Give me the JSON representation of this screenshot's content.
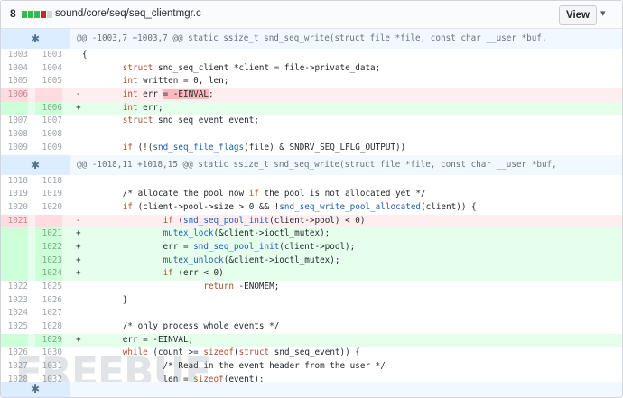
{
  "header": {
    "change_count": "8",
    "bar_colors": [
      "#2cbe4e",
      "#2cbe4e",
      "#2cbe4e",
      "#cb2431",
      "#d1d5da"
    ],
    "file_path": "sound/core/seq/seq_clientmgr.c",
    "view_label": "View",
    "menu_icon": "chevron-down-icon"
  },
  "hunks": [
    {
      "header": "@@ -1003,7 +1003,7 @@ static ssize_t snd_seq_write(struct file *file, const char __user *buf,"
    },
    {
      "header": "@@ -1018,11 +1018,15 @@ static ssize_t snd_seq_write(struct file *file, const char __user *buf,"
    }
  ],
  "lines": [
    {
      "old": "1003",
      "new": "1003",
      "sign": "",
      "text": "{"
    },
    {
      "old": "1004",
      "new": "1004",
      "sign": "",
      "text": "        struct snd_seq_client *client = file->private_data;"
    },
    {
      "old": "1005",
      "new": "1005",
      "sign": "",
      "text": "        int written = 0, len;"
    },
    {
      "old": "1006",
      "new": "",
      "sign": "-",
      "text": "        int err = -EINVAL;"
    },
    {
      "old": "",
      "new": "1006",
      "sign": "+",
      "text": "        int err;"
    },
    {
      "old": "1007",
      "new": "1007",
      "sign": "",
      "text": "        struct snd_seq_event event;"
    },
    {
      "old": "1008",
      "new": "1008",
      "sign": "",
      "text": ""
    },
    {
      "old": "1009",
      "new": "1009",
      "sign": "",
      "text": "        if (!(snd_seq_file_flags(file) & SNDRV_SEQ_LFLG_OUTPUT))"
    },
    {
      "old": "1018",
      "new": "1018",
      "sign": "",
      "text": ""
    },
    {
      "old": "1019",
      "new": "1019",
      "sign": "",
      "text": "        /* allocate the pool now if the pool is not allocated yet */"
    },
    {
      "old": "1020",
      "new": "1020",
      "sign": "",
      "text": "        if (client->pool->size > 0 && !snd_seq_write_pool_allocated(client)) {"
    },
    {
      "old": "1021",
      "new": "",
      "sign": "-",
      "text": "                if (snd_seq_pool_init(client->pool) < 0)"
    },
    {
      "old": "",
      "new": "1021",
      "sign": "+",
      "text": "                mutex_lock(&client->ioctl_mutex);"
    },
    {
      "old": "",
      "new": "1022",
      "sign": "+",
      "text": "                err = snd_seq_pool_init(client->pool);"
    },
    {
      "old": "",
      "new": "1023",
      "sign": "+",
      "text": "                mutex_unlock(&client->ioctl_mutex);"
    },
    {
      "old": "",
      "new": "1024",
      "sign": "+",
      "text": "                if (err < 0)"
    },
    {
      "old": "1022",
      "new": "1025",
      "sign": "",
      "text": "                        return -ENOMEM;"
    },
    {
      "old": "1023",
      "new": "1026",
      "sign": "",
      "text": "        }"
    },
    {
      "old": "1024",
      "new": "1027",
      "sign": "",
      "text": ""
    },
    {
      "old": "1025",
      "new": "1028",
      "sign": "",
      "text": "        /* only process whole events */"
    },
    {
      "old": "",
      "new": "1029",
      "sign": "+",
      "text": "        err = -EINVAL;"
    },
    {
      "old": "1026",
      "new": "1030",
      "sign": "",
      "text": "        while (count >= sizeof(struct snd_seq_event)) {"
    },
    {
      "old": "1027",
      "new": "1031",
      "sign": "",
      "text": "                /* Read in the event header from the user */"
    },
    {
      "old": "1028",
      "new": "1032",
      "sign": "",
      "text": "                len = sizeof(event);"
    }
  ],
  "expand_icon": "unfold-icon",
  "watermark": "FREEBUF"
}
